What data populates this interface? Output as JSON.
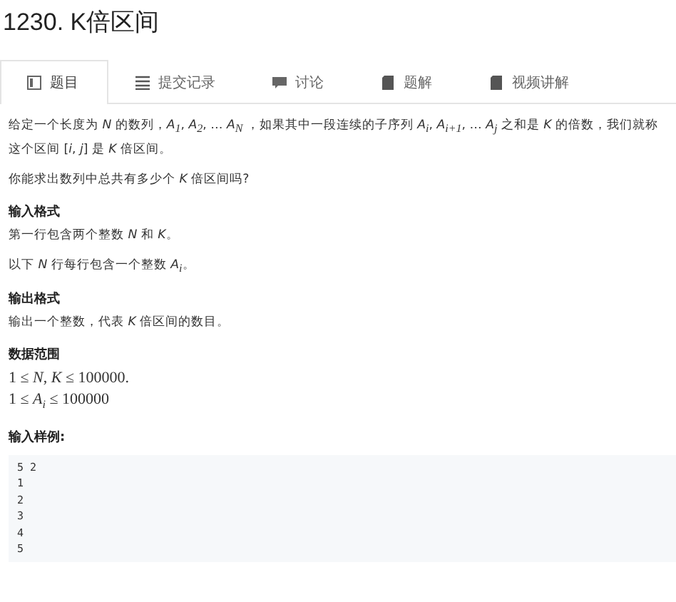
{
  "title": "1230. K倍区间",
  "tabs": [
    {
      "kind": "document",
      "label": "题目",
      "selected": true
    },
    {
      "kind": "list",
      "label": "提交记录",
      "selected": false
    },
    {
      "kind": "chat",
      "label": "讨论",
      "selected": false
    },
    {
      "kind": "book",
      "label": "题解",
      "selected": false
    },
    {
      "kind": "book",
      "label": "视频讲解",
      "selected": false
    }
  ],
  "blocks": [
    {
      "kind": "paragraph",
      "text": "给定一个长度为 *N* 的数列，*A*$_{1}$, *A*$_{2}$, … *A*$_{N}$ ，如果其中一段连续的子序列 *A*$_{i}$, *A*$_{i+1}$, … *A*$_{j}$ 之和是 *K* 的倍数，我们就称这个区间 [*i*, *j*] 是 *K* 倍区间。"
    },
    {
      "kind": "paragraph",
      "text": "你能求出数列中总共有多少个 *K* 倍区间吗?"
    },
    {
      "kind": "heading",
      "text": "输入格式"
    },
    {
      "kind": "paragraph",
      "text": "第一行包含两个整数 *N* 和 *K*。"
    },
    {
      "kind": "paragraph",
      "text": "以下 *N* 行每行包含一个整数 *A*$_{i}$。"
    },
    {
      "kind": "heading",
      "text": "输出格式"
    },
    {
      "kind": "paragraph",
      "text": "输出一个整数，代表 *K* 倍区间的数目。"
    },
    {
      "kind": "heading",
      "text": "数据范围"
    },
    {
      "kind": "math",
      "lines": [
        "1 ≤ *N*, *K* ≤ 100000.",
        "1 ≤ *A*$_{i}$ ≤ 100000"
      ]
    },
    {
      "kind": "heading",
      "text": "输入样例:"
    },
    {
      "kind": "code",
      "lines": [
        "5 2",
        "1",
        "2",
        "3",
        "4",
        "5"
      ]
    }
  ]
}
